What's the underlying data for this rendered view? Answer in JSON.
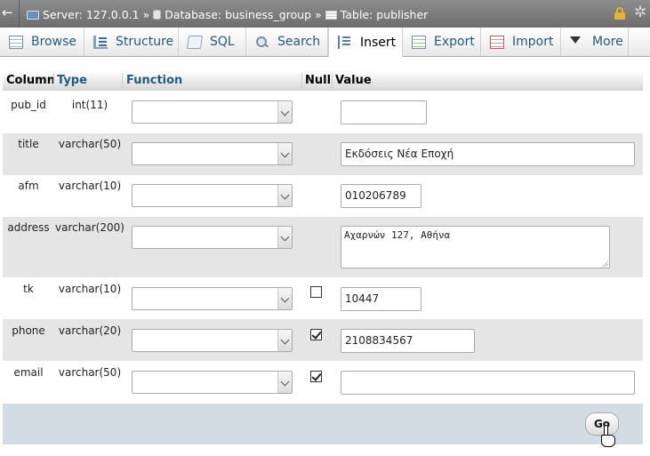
{
  "breadcrumb": {
    "server": "Server: 127.0.0.1",
    "database": "Database: business_group",
    "table": "Table: publisher",
    "separator": "»"
  },
  "tabs": [
    {
      "label": "Browse",
      "icon": "browse-icon"
    },
    {
      "label": "Structure",
      "icon": "structure-icon"
    },
    {
      "label": "SQL",
      "icon": "sql-icon"
    },
    {
      "label": "Search",
      "icon": "search-icon"
    },
    {
      "label": "Insert",
      "icon": "insert-icon",
      "active": true
    },
    {
      "label": "Export",
      "icon": "export-icon"
    },
    {
      "label": "Import",
      "icon": "import-icon"
    },
    {
      "label": "More",
      "icon": "chevron-down-icon"
    }
  ],
  "table": {
    "headers": {
      "column": "Column",
      "type": "Type",
      "function": "Function",
      "null": "Null",
      "value": "Value"
    },
    "rows": [
      {
        "column": "pub_id",
        "type": "int(11)",
        "function": "",
        "null_shown": false,
        "null_checked": false,
        "value": ""
      },
      {
        "column": "title",
        "type": "varchar(50)",
        "function": "",
        "null_shown": false,
        "null_checked": false,
        "value": "Εκδόσεις Νέα Εποχή"
      },
      {
        "column": "afm",
        "type": "varchar(10)",
        "function": "",
        "null_shown": false,
        "null_checked": false,
        "value": "010206789"
      },
      {
        "column": "address",
        "type": "varchar(200)",
        "function": "",
        "null_shown": false,
        "null_checked": false,
        "value": "Αχαρνών 127, Αθήνα"
      },
      {
        "column": "tk",
        "type": "varchar(10)",
        "function": "",
        "null_shown": true,
        "null_checked": false,
        "value": "10447"
      },
      {
        "column": "phone",
        "type": "varchar(20)",
        "function": "",
        "null_shown": true,
        "null_checked": true,
        "value": "2108834567"
      },
      {
        "column": "email",
        "type": "varchar(50)",
        "function": "",
        "null_shown": true,
        "null_checked": true,
        "value": ""
      }
    ]
  },
  "footer": {
    "go_label": "Go"
  },
  "colors": {
    "link": "#235a81",
    "row_alt": "#e5e5e5",
    "footer_bg": "#d3dce3",
    "lock": "#e2b33b"
  }
}
